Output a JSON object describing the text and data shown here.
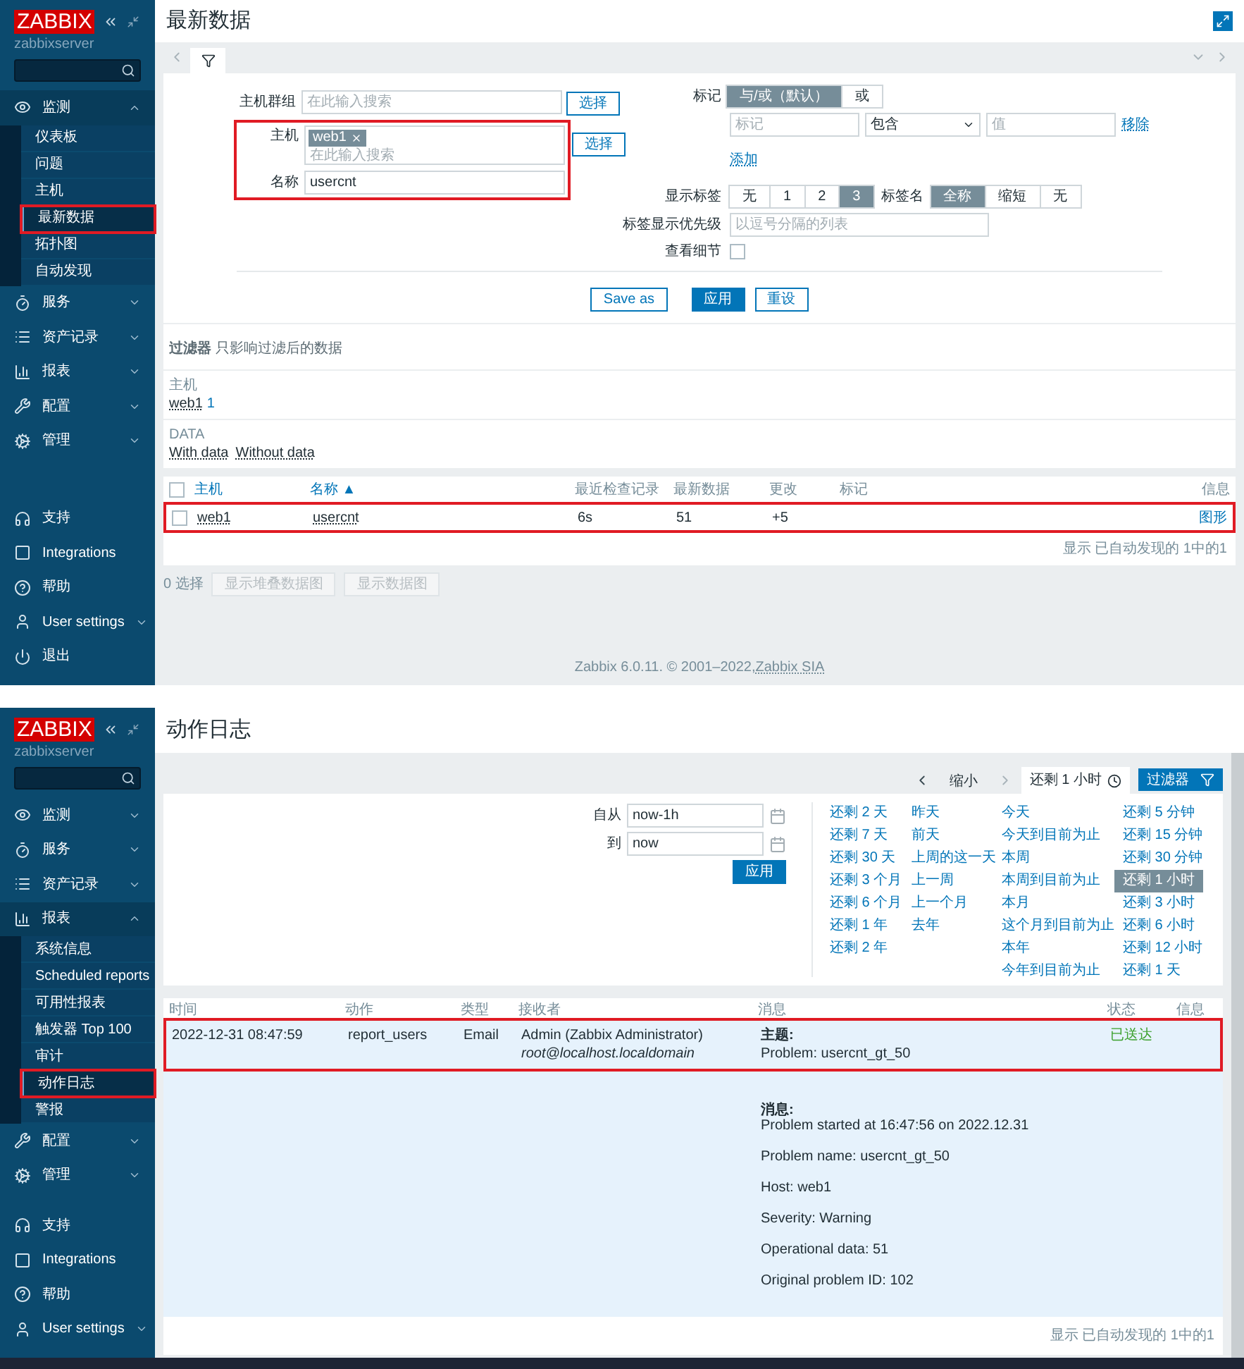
{
  "latest_data": {
    "sidebar": {
      "logo": "ZABBIX",
      "server": "zabbixserver",
      "menu": [
        {
          "label": "监测",
          "expanded": true,
          "children": [
            {
              "label": "仪表板",
              "selected": false,
              "highlighted": false
            },
            {
              "label": "问题",
              "selected": false,
              "highlighted": false
            },
            {
              "label": "主机",
              "selected": false,
              "highlighted": false
            },
            {
              "label": "最新数据",
              "selected": true,
              "highlighted": true
            },
            {
              "label": "拓扑图",
              "selected": false,
              "highlighted": false
            },
            {
              "label": "自动发现",
              "selected": false,
              "highlighted": false
            }
          ]
        },
        {
          "label": "服务",
          "expanded": false
        },
        {
          "label": "资产记录",
          "expanded": false
        },
        {
          "label": "报表",
          "expanded": false
        },
        {
          "label": "配置",
          "expanded": false
        },
        {
          "label": "管理",
          "expanded": false
        }
      ],
      "bottom": [
        {
          "label": "支持"
        },
        {
          "label": "Integrations"
        },
        {
          "label": "帮助"
        },
        {
          "label": "User settings",
          "expanded": false
        },
        {
          "label": "退出"
        }
      ]
    },
    "title": "最新数据",
    "filter": {
      "host_groups": {
        "label": "主机群组",
        "placeholder": "在此输入搜索",
        "button": "选择"
      },
      "hosts": {
        "label": "主机",
        "chips": [
          "web1"
        ],
        "placeholder": "在此输入搜索",
        "button": "选择",
        "highlighted": true
      },
      "name": {
        "label": "名称",
        "value": "usercnt"
      },
      "tags": {
        "label": "标记",
        "operators": [
          {
            "label": "与/或（默认）",
            "selected": true
          },
          {
            "label": "或",
            "selected": false
          }
        ],
        "tag_placeholder": "标记",
        "condition": "包含",
        "value_placeholder": "值",
        "remove": "移除",
        "add": "添加"
      },
      "show_tags": {
        "label": "显示标签",
        "options": [
          {
            "label": "无",
            "selected": false
          },
          {
            "label": "1",
            "selected": false
          },
          {
            "label": "2",
            "selected": false
          },
          {
            "label": "3",
            "selected": true
          }
        ]
      },
      "tag_name": {
        "label": "标签名",
        "options": [
          {
            "label": "全称",
            "selected": true
          },
          {
            "label": "缩短",
            "selected": false
          },
          {
            "label": "无",
            "selected": false
          }
        ]
      },
      "tag_priority": {
        "label": "标签显示优先级",
        "placeholder": "以逗号分隔的列表"
      },
      "show_details": {
        "label": "查看细节",
        "checked": false
      },
      "buttons": [
        {
          "label": "Save as",
          "kind": "secondary"
        },
        {
          "label": "应用",
          "kind": "primary"
        },
        {
          "label": "重设",
          "kind": "secondary"
        }
      ]
    },
    "subfilter": {
      "title": "**过滤器** 只影响过滤后的数据",
      "groups": [
        {
          "label": "主机",
          "items": [
            {
              "label": "web1",
              "count": "1"
            }
          ]
        },
        {
          "label": "DATA",
          "items": [
            {
              "label": "With data"
            },
            {
              "label": "Without data"
            }
          ]
        }
      ]
    },
    "table": {
      "select_all_checked": false,
      "columns": [
        {
          "label": "主机",
          "sortable": true
        },
        {
          "label": "名称 ▲",
          "sortable": true
        },
        {
          "label": "最近检查记录",
          "sortable": false
        },
        {
          "label": "最新数据",
          "sortable": false
        },
        {
          "label": "更改",
          "sortable": false
        },
        {
          "label": "标记",
          "sortable": false
        },
        {
          "label": "信息",
          "sortable": false
        }
      ],
      "rows": [
        {
          "checked": false,
          "highlighted": true,
          "host": "web1",
          "name": "usercnt",
          "last_check": "6s",
          "last_value": "51",
          "change": "+5",
          "graph": "图形"
        }
      ],
      "footer": "显示 已自动发现的 1中的1"
    },
    "selection": {
      "count": "0 选择",
      "buttons": [
        {
          "label": "显示堆叠数据图",
          "disabled": true
        },
        {
          "label": "显示数据图",
          "disabled": true
        }
      ]
    },
    "footer": {
      "text": "Zabbix 6.0.11. © 2001–2022, ",
      "link": "Zabbix SIA"
    }
  },
  "action_log": {
    "sidebar": {
      "logo": "ZABBIX",
      "server": "zabbixserver",
      "menu": [
        {
          "label": "监测",
          "expanded": false
        },
        {
          "label": "服务",
          "expanded": false
        },
        {
          "label": "资产记录",
          "expanded": false
        },
        {
          "label": "报表",
          "expanded": true,
          "children": [
            {
              "label": "系统信息",
              "selected": false,
              "highlighted": false
            },
            {
              "label": "Scheduled reports",
              "selected": false,
              "highlighted": false
            },
            {
              "label": "可用性报表",
              "selected": false,
              "highlighted": false
            },
            {
              "label": "触发器 Top 100",
              "selected": false,
              "highlighted": false
            },
            {
              "label": "审计",
              "selected": false,
              "highlighted": false
            },
            {
              "label": "动作日志",
              "selected": true,
              "highlighted": true
            },
            {
              "label": "警报",
              "selected": false,
              "highlighted": false
            }
          ]
        },
        {
          "label": "配置",
          "expanded": false
        },
        {
          "label": "管理",
          "expanded": false
        }
      ],
      "bottom": [
        {
          "label": "支持"
        },
        {
          "label": "Integrations"
        },
        {
          "label": "帮助"
        },
        {
          "label": "User settings",
          "expanded": false
        }
      ]
    },
    "title": "动作日志",
    "time_nav": {
      "zoom_out": "缩小",
      "range": "还剩 1 小时",
      "filter_button": "过滤器"
    },
    "time_filter": {
      "from": {
        "label": "自从",
        "value": "now-1h"
      },
      "to": {
        "label": "到",
        "value": "now"
      },
      "apply": "应用",
      "quick_ranges": [
        {
          "items": [
            {
              "label": "还剩 2 天",
              "selected": false
            },
            {
              "label": "还剩 7 天",
              "selected": false
            },
            {
              "label": "还剩 30 天",
              "selected": false
            },
            {
              "label": "还剩 3 个月",
              "selected": false
            },
            {
              "label": "还剩 6 个月",
              "selected": false
            },
            {
              "label": "还剩 1 年",
              "selected": false
            },
            {
              "label": "还剩 2 年",
              "selected": false
            }
          ]
        },
        {
          "items": [
            {
              "label": "昨天",
              "selected": false
            },
            {
              "label": "前天",
              "selected": false
            },
            {
              "label": "上周的这一天",
              "selected": false
            },
            {
              "label": "上一周",
              "selected": false
            },
            {
              "label": "上一个月",
              "selected": false
            },
            {
              "label": "去年",
              "selected": false
            }
          ]
        },
        {
          "items": [
            {
              "label": "今天",
              "selected": false
            },
            {
              "label": "今天到目前为止",
              "selected": false
            },
            {
              "label": "本周",
              "selected": false
            },
            {
              "label": "本周到目前为止",
              "selected": false
            },
            {
              "label": "本月",
              "selected": false
            },
            {
              "label": "这个月到目前为止",
              "selected": false
            },
            {
              "label": "本年",
              "selected": false
            },
            {
              "label": "今年到目前为止",
              "selected": false
            }
          ]
        },
        {
          "items": [
            {
              "label": "还剩 5 分钟",
              "selected": false
            },
            {
              "label": "还剩 15 分钟",
              "selected": false
            },
            {
              "label": "还剩 30 分钟",
              "selected": false
            },
            {
              "label": "还剩 1 小时",
              "selected": true
            },
            {
              "label": "还剩 3 小时",
              "selected": false
            },
            {
              "label": "还剩 6 小时",
              "selected": false
            },
            {
              "label": "还剩 12 小时",
              "selected": false
            },
            {
              "label": "还剩 1 天",
              "selected": false
            }
          ]
        }
      ]
    },
    "table": {
      "columns": [
        "时间",
        "动作",
        "类型",
        "接收者",
        "消息",
        "状态",
        "信息"
      ],
      "rows": [
        {
          "highlighted": true,
          "time": "2022-12-31 08:47:59",
          "action": "report_users",
          "type": "Email",
          "recipient_name": "Admin (Zabbix Administrator)",
          "recipient_address": "root@localhost.localdomain",
          "subject_label": "主题:",
          "subject": "Problem: usercnt_gt_50",
          "message_label": "消息:",
          "message_lines": [
            "Problem started at 16:47:56 on 2022.12.31",
            "Problem name: usercnt_gt_50",
            "Host: web1",
            "Severity: Warning",
            "Operational data: 51",
            "Original problem ID: 102"
          ],
          "status": "已送达"
        }
      ],
      "footer": "显示 已自动发现的 1中的1"
    }
  }
}
